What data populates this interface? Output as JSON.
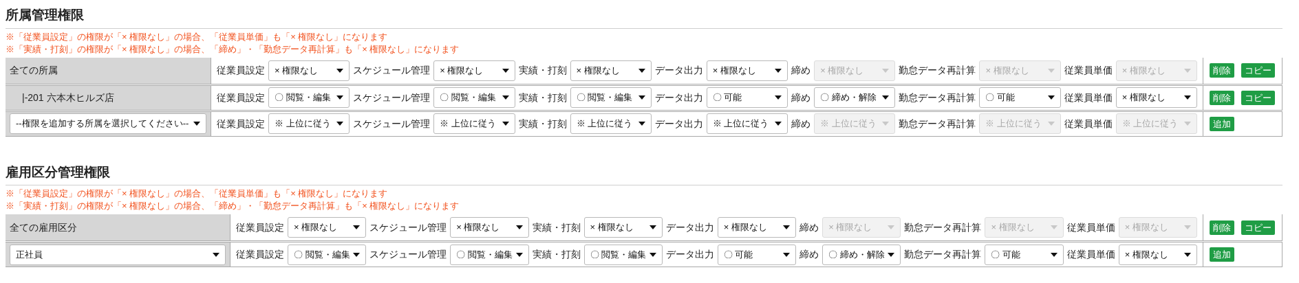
{
  "sections": [
    {
      "title": "所属管理権限",
      "notes": [
        "※「従業員設定」の権限が「× 権限なし」の場合、「従業員単価」も「× 権限なし」になります",
        "※「実績・打刻」の権限が「× 権限なし」の場合、「締め」・「勤怠データ再計算」も「× 権限なし」になります"
      ],
      "rows": [
        {
          "head": {
            "kind": "label",
            "text": "全ての所属"
          },
          "fields": [
            {
              "label": "従業員設定",
              "value": "× 権限なし",
              "disabled": false
            },
            {
              "label": "スケジュール管理",
              "value": "× 権限なし",
              "disabled": false
            },
            {
              "label": "実績・打刻",
              "value": "× 権限なし",
              "disabled": false
            },
            {
              "label": "データ出力",
              "value": "× 権限なし",
              "disabled": false
            },
            {
              "label": "締め",
              "value": "× 権限なし",
              "disabled": true
            },
            {
              "label": "勤怠データ再計算",
              "value": "× 権限なし",
              "disabled": true
            },
            {
              "label": "従業員単価",
              "value": "× 権限なし",
              "disabled": true
            }
          ],
          "buttons": [
            "削除",
            "コピー"
          ]
        },
        {
          "head": {
            "kind": "label",
            "text": "|-201 六本木ヒルズ店"
          },
          "fields": [
            {
              "label": "従業員設定",
              "value": "〇 閲覧・編集",
              "disabled": false
            },
            {
              "label": "スケジュール管理",
              "value": "〇 閲覧・編集",
              "disabled": false
            },
            {
              "label": "実績・打刻",
              "value": "〇 閲覧・編集",
              "disabled": false
            },
            {
              "label": "データ出力",
              "value": "〇 可能",
              "disabled": false
            },
            {
              "label": "締め",
              "value": "〇 締め・解除",
              "disabled": false
            },
            {
              "label": "勤怠データ再計算",
              "value": "〇 可能",
              "disabled": false
            },
            {
              "label": "従業員単価",
              "value": "× 権限なし",
              "disabled": false
            }
          ],
          "buttons": [
            "削除",
            "コピー"
          ]
        },
        {
          "head": {
            "kind": "select",
            "text": "--権限を追加する所属を選択してください--"
          },
          "fields": [
            {
              "label": "従業員設定",
              "value": "※ 上位に従う",
              "disabled": false
            },
            {
              "label": "スケジュール管理",
              "value": "※ 上位に従う",
              "disabled": false
            },
            {
              "label": "実績・打刻",
              "value": "※ 上位に従う",
              "disabled": false
            },
            {
              "label": "データ出力",
              "value": "※ 上位に従う",
              "disabled": false
            },
            {
              "label": "締め",
              "value": "※ 上位に従う",
              "disabled": true
            },
            {
              "label": "勤怠データ再計算",
              "value": "※ 上位に従う",
              "disabled": true
            },
            {
              "label": "従業員単価",
              "value": "※ 上位に従う",
              "disabled": true
            }
          ],
          "buttons": [
            "追加"
          ]
        }
      ]
    },
    {
      "title": "雇用区分管理権限",
      "notes": [
        "※「従業員設定」の権限が「× 権限なし」の場合、「従業員単価」も「× 権限なし」になります",
        "※「実績・打刻」の権限が「× 権限なし」の場合、「締め」・「勤怠データ再計算」も「× 権限なし」になります"
      ],
      "rows": [
        {
          "head": {
            "kind": "label",
            "text": "全ての雇用区分"
          },
          "fields": [
            {
              "label": "従業員設定",
              "value": "× 権限なし",
              "disabled": false
            },
            {
              "label": "スケジュール管理",
              "value": "× 権限なし",
              "disabled": false
            },
            {
              "label": "実績・打刻",
              "value": "× 権限なし",
              "disabled": false
            },
            {
              "label": "データ出力",
              "value": "× 権限なし",
              "disabled": false
            },
            {
              "label": "締め",
              "value": "× 権限なし",
              "disabled": true
            },
            {
              "label": "勤怠データ再計算",
              "value": "× 権限なし",
              "disabled": true
            },
            {
              "label": "従業員単価",
              "value": "× 権限なし",
              "disabled": true
            }
          ],
          "buttons": [
            "削除",
            "コピー"
          ]
        },
        {
          "head": {
            "kind": "select",
            "text": "正社員"
          },
          "fields": [
            {
              "label": "従業員設定",
              "value": "〇 閲覧・編集",
              "disabled": false
            },
            {
              "label": "スケジュール管理",
              "value": "〇 閲覧・編集",
              "disabled": false
            },
            {
              "label": "実績・打刻",
              "value": "〇 閲覧・編集",
              "disabled": false
            },
            {
              "label": "データ出力",
              "value": "〇 可能",
              "disabled": false
            },
            {
              "label": "締め",
              "value": "〇 締め・解除",
              "disabled": false
            },
            {
              "label": "勤怠データ再計算",
              "value": "〇 可能",
              "disabled": false
            },
            {
              "label": "従業員単価",
              "value": "× 権限なし",
              "disabled": false
            }
          ],
          "buttons": [
            "追加"
          ]
        }
      ]
    }
  ]
}
